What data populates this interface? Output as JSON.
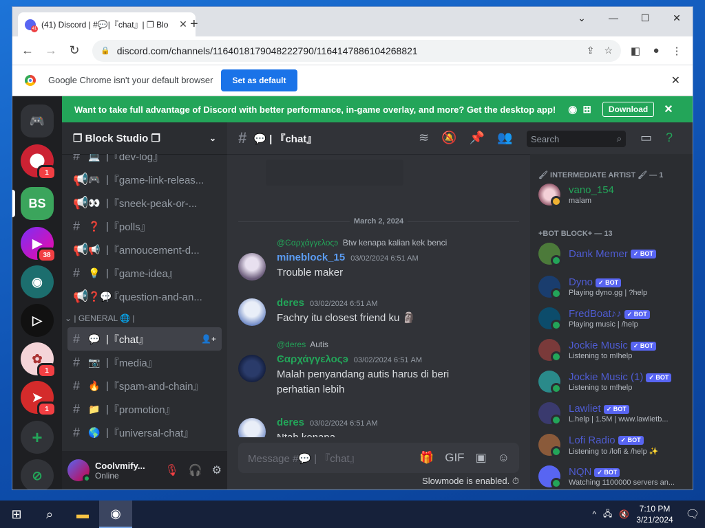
{
  "browser": {
    "tab_title": "(41) Discord | #💬|『chat』| ❐ Blo",
    "tab_badge": "41",
    "url": "discord.com/channels/1164018179048222790/1164147886104268821",
    "infobar_text": "Google Chrome isn't your default browser",
    "set_default": "Set as default"
  },
  "banner": {
    "text": "Want to take full advantage of Discord with better performance, in-game overlay, and more? Get the desktop app!",
    "download": "Download"
  },
  "server": {
    "name": "❐ Block Studio ❐"
  },
  "rail": {
    "badges": [
      "1",
      "38",
      "1",
      "1"
    ]
  },
  "channels": [
    {
      "emoji": "💻",
      "label": "『dev-log』"
    },
    {
      "emoji": "🎮",
      "label": "『game-link-releas..."
    },
    {
      "emoji": "👀",
      "label": "『sneek-peak-or-..."
    },
    {
      "emoji": "❓",
      "label": "『polls』"
    },
    {
      "emoji": "📢",
      "label": "『annoucement-d..."
    },
    {
      "emoji": "💡",
      "label": "『game-idea』"
    },
    {
      "emoji": "❓💬",
      "label": "『question-and-an..."
    }
  ],
  "category": "| GENERAL 🌐 |",
  "general_channels": [
    {
      "emoji": "💬",
      "label": "『chat』"
    },
    {
      "emoji": "📷",
      "label": "『media』"
    },
    {
      "emoji": "🔥",
      "label": "『spam-and-chain』"
    },
    {
      "emoji": "📁",
      "label": "『promotion』"
    },
    {
      "emoji": "🌎",
      "label": "『universal-chat』"
    }
  ],
  "user": {
    "name": "Coolvmify...",
    "status": "Online"
  },
  "chat": {
    "title": "💬 | 『chat』",
    "date_divider": "March 2, 2024",
    "messages": [
      {
        "reply_user": "@Ͼαρχάγγελοςͽ",
        "reply_text": "Btw kenapa kalian kek benci",
        "author": "mineblock_15",
        "author_color": "#5b9cf2",
        "time": "03/02/2024 6:51 AM",
        "text": "Trouble maker"
      },
      {
        "author": "deres",
        "author_color": "#23a559",
        "time": "03/02/2024 6:51 AM",
        "text": "Fachry itu closest friend ku 🗿"
      },
      {
        "reply_user": "@deres",
        "reply_text": "Autis",
        "author": "Ͼαρχάγγελοςͽ",
        "author_color": "#23a559",
        "time": "03/02/2024 6:51 AM",
        "text": "Malah penyandang autis harus di beri perhatian lebih"
      },
      {
        "author": "deres",
        "author_color": "#23a559",
        "time": "03/02/2024 6:51 AM",
        "text": "Ntah kenapa"
      }
    ],
    "composer_placeholder": "Message #💬 | 『chat』",
    "slowmode": "Slowmode is enabled. ⏱"
  },
  "search": {
    "placeholder": "Search"
  },
  "members": {
    "role1": "🖌 INTERMEDIATE ARTIST 🖌 — 1",
    "role2": "+BOT BLOCK+ — 13",
    "list1": [
      {
        "name": "vano_154",
        "status": "malam"
      }
    ],
    "bots": [
      {
        "name": "Dank Memer",
        "status": ""
      },
      {
        "name": "Dyno",
        "status": "Playing dyno.gg | ?help"
      },
      {
        "name": "FredBoat♪♪",
        "status": "Playing music | /help"
      },
      {
        "name": "Jockie Music",
        "status": "Listening to m!help"
      },
      {
        "name": "Jockie Music (1)",
        "status": "Listening to m!help"
      },
      {
        "name": "Lawliet",
        "status": "L.help | 1.5M | www.lawlietb..."
      },
      {
        "name": "Lofi Radio",
        "status": "Listening to /lofi & /help ✨"
      },
      {
        "name": "NQN",
        "status": "Watching 1100000 servers an..."
      }
    ],
    "bot_tag": "✓ BOT"
  },
  "taskbar": {
    "time": "7:10 PM",
    "date": "3/21/2024"
  }
}
